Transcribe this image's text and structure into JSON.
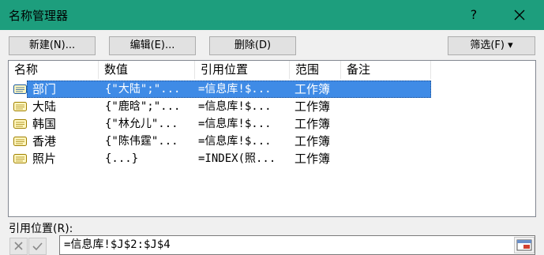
{
  "window": {
    "title": "名称管理器",
    "help_label": "?",
    "accent": "#1d9e7d"
  },
  "toolbar": {
    "new_label": "新建(N)...",
    "edit_label": "编辑(E)...",
    "delete_label": "删除(D)",
    "filter_label": "筛选(F) ▾"
  },
  "list": {
    "columns": [
      "名称",
      "数值",
      "引用位置",
      "范围",
      "备注"
    ],
    "rows": [
      {
        "name": "部门",
        "value": "{\"大陆\";\"...",
        "ref": "=信息库!$...",
        "scope": "工作簿",
        "selected": true
      },
      {
        "name": "大陆",
        "value": "{\"鹿晗\";\"...",
        "ref": "=信息库!$...",
        "scope": "工作簿"
      },
      {
        "name": "韩国",
        "value": "{\"林允儿\"...",
        "ref": "=信息库!$...",
        "scope": "工作簿"
      },
      {
        "name": "香港",
        "value": "{\"陈伟霆\"...",
        "ref": "=信息库!$...",
        "scope": "工作簿"
      },
      {
        "name": "照片",
        "value": "{...}",
        "ref": "=INDEX(照...",
        "scope": "工作簿"
      }
    ],
    "selected_color": "#3f8be6"
  },
  "refers_to": {
    "label": "引用位置(R):",
    "value": "=信息库!$J$2:$J$4"
  }
}
